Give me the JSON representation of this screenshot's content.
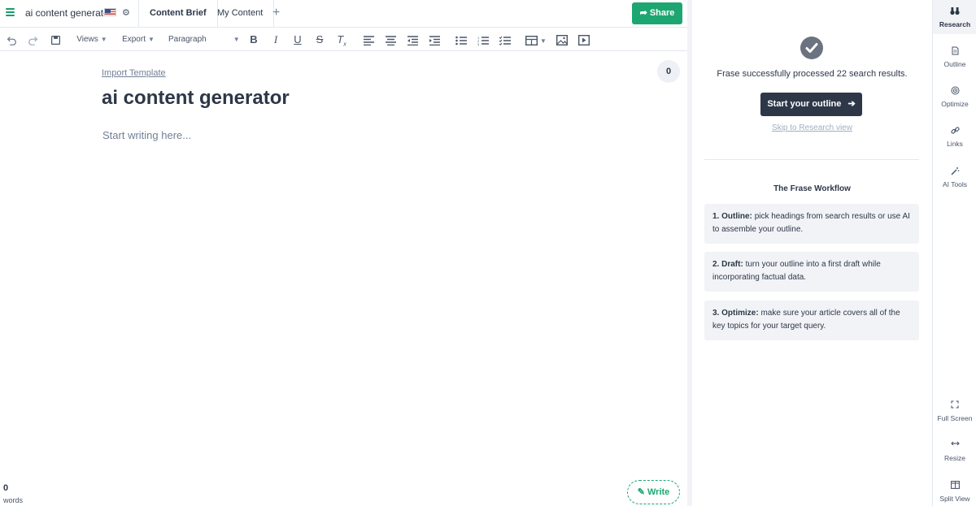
{
  "header": {
    "doc_title": "ai content generator",
    "tabs": [
      {
        "label": "Content Brief"
      },
      {
        "label": "My Content"
      }
    ],
    "add_tab_glyph": "+",
    "share_label": "Share",
    "accent_color": "#1ea672"
  },
  "toolbar": {
    "views_label": "Views",
    "export_label": "Export",
    "paragraph_label": "Paragraph"
  },
  "editor": {
    "import_template": "Import Template",
    "heading": "ai content generator",
    "placeholder": "Start writing here...",
    "counter": "0",
    "word_count": "0",
    "word_label": "words",
    "write_label": "Write"
  },
  "research": {
    "processed_text": "Frase successfully processed 22 search results.",
    "start_outline_label": "Start your outline",
    "skip_label": "Skip to Research view",
    "workflow_title": "The Frase Workflow",
    "steps": [
      {
        "title": "1. Outline:",
        "text": "pick headings from search results or use AI to assemble your outline."
      },
      {
        "title": "2. Draft:",
        "text": "turn your outline into a first draft while incorporating factual data."
      },
      {
        "title": "3. Optimize:",
        "text": "make sure your article covers all of the key topics for your target query."
      }
    ]
  },
  "rail": {
    "top": [
      {
        "label": "Research",
        "icon": "binoculars-icon"
      },
      {
        "label": "Outline",
        "icon": "document-icon"
      },
      {
        "label": "Optimize",
        "icon": "target-icon"
      },
      {
        "label": "Links",
        "icon": "link-icon"
      },
      {
        "label": "AI Tools",
        "icon": "magic-wand-icon"
      }
    ],
    "bottom": [
      {
        "label": "Full Screen",
        "icon": "expand-icon"
      },
      {
        "label": "Resize",
        "icon": "resize-icon"
      },
      {
        "label": "Split View",
        "icon": "split-view-icon"
      }
    ]
  }
}
